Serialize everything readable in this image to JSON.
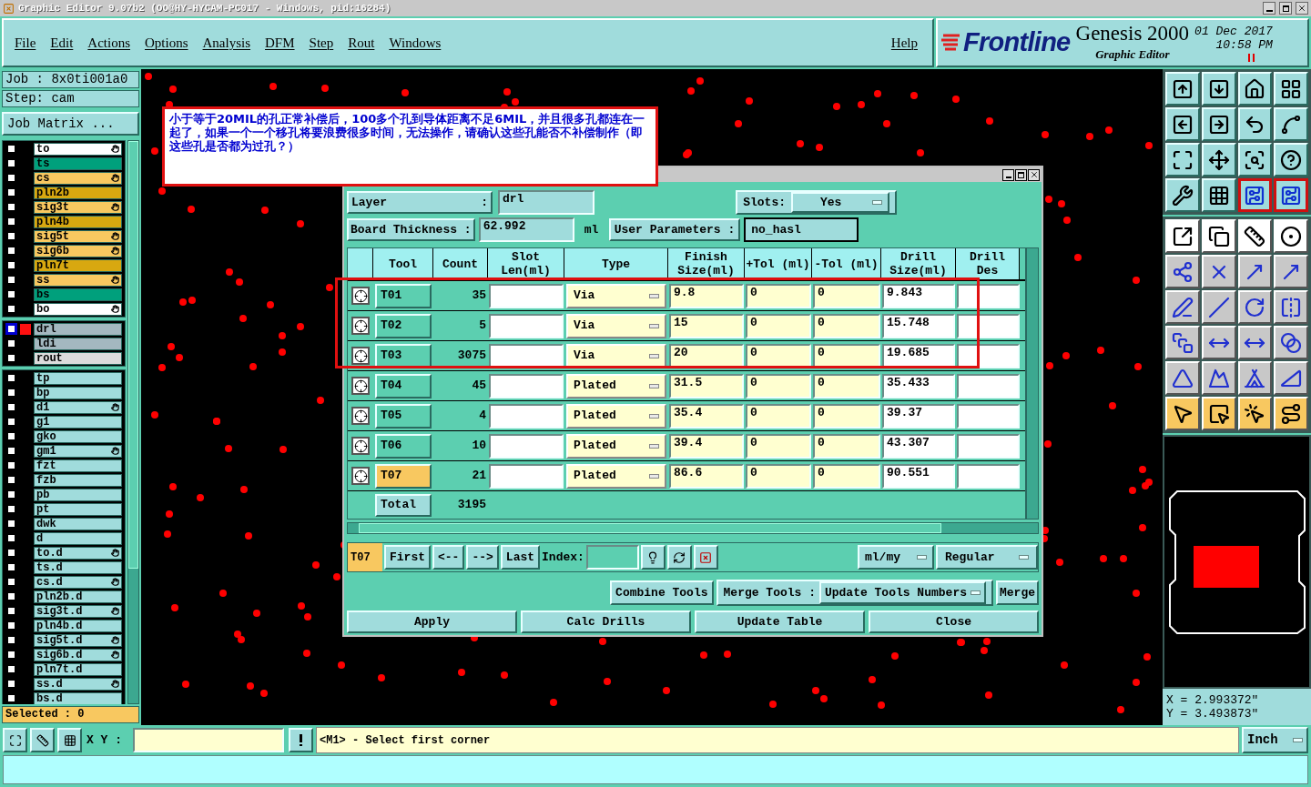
{
  "title_bar": {
    "title": "Graphic Editor 9.07b2 (OO@HY-HYCAM-PC017 - Windows, pid:16284)"
  },
  "menu": [
    "File",
    "Edit",
    "Actions",
    "Options",
    "Analysis",
    "DFM",
    "Step",
    "Rout",
    "Windows"
  ],
  "help": "Help",
  "brand": {
    "logo": "Frontline",
    "product": "Genesis 2000",
    "subtitle": "Graphic Editor",
    "date": "01 Dec 2017",
    "time": "10:58 PM"
  },
  "job": {
    "job": "Job : 8x0ti001a0",
    "step": "Step: cam",
    "matrix_button": "Job Matrix ...",
    "selected": "Selected : 0"
  },
  "layer_groups": [
    [
      {
        "name": "to",
        "color": "#ffffff",
        "marked": true,
        "checked": false,
        "selected": false
      },
      {
        "name": "ts",
        "color": "#00a07c",
        "marked": false,
        "checked": false,
        "selected": false
      },
      {
        "name": "cs",
        "color": "#f8c860",
        "marked": true,
        "checked": false,
        "selected": false
      },
      {
        "name": "pln2b",
        "color": "#d8a810",
        "marked": false,
        "checked": false,
        "selected": false
      },
      {
        "name": "sig3t",
        "color": "#f8c860",
        "marked": true,
        "checked": false,
        "selected": false
      },
      {
        "name": "pln4b",
        "color": "#d8a810",
        "marked": false,
        "checked": false,
        "selected": false
      },
      {
        "name": "sig5t",
        "color": "#f8c860",
        "marked": true,
        "checked": false,
        "selected": false
      },
      {
        "name": "sig6b",
        "color": "#f8c860",
        "marked": true,
        "checked": false,
        "selected": false
      },
      {
        "name": "pln7t",
        "color": "#d8a810",
        "marked": false,
        "checked": false,
        "selected": false
      },
      {
        "name": "ss",
        "color": "#f8c860",
        "marked": true,
        "checked": false,
        "selected": false
      },
      {
        "name": "bs",
        "color": "#00a07c",
        "marked": false,
        "checked": false,
        "selected": false
      },
      {
        "name": "bo",
        "color": "#ffffff",
        "marked": true,
        "checked": false,
        "selected": false
      }
    ],
    [
      {
        "name": "drl",
        "color": "#a4b8c0",
        "marked": false,
        "checked": false,
        "selected": true
      },
      {
        "name": "ldi",
        "color": "#a4b8c0",
        "marked": false,
        "checked": false,
        "selected": false
      },
      {
        "name": "rout",
        "color": "#dcdcdc",
        "marked": false,
        "checked": false,
        "selected": false
      }
    ],
    [
      {
        "name": "tp",
        "color": "#a0dcdc",
        "marked": false,
        "checked": false,
        "selected": false
      },
      {
        "name": "bp",
        "color": "#a0dcdc",
        "marked": false,
        "checked": false,
        "selected": false
      },
      {
        "name": "d1",
        "color": "#a0dcdc",
        "marked": true,
        "checked": false,
        "selected": false
      },
      {
        "name": "g1",
        "color": "#a0dcdc",
        "marked": false,
        "checked": false,
        "selected": false
      },
      {
        "name": "gko",
        "color": "#a0dcdc",
        "marked": false,
        "checked": false,
        "selected": false
      },
      {
        "name": "gm1",
        "color": "#a0dcdc",
        "marked": true,
        "checked": false,
        "selected": false
      },
      {
        "name": "fzt",
        "color": "#a0dcdc",
        "marked": false,
        "checked": false,
        "selected": false
      },
      {
        "name": "fzb",
        "color": "#a0dcdc",
        "marked": false,
        "checked": false,
        "selected": false
      },
      {
        "name": "pb",
        "color": "#a0dcdc",
        "marked": false,
        "checked": false,
        "selected": false
      },
      {
        "name": "pt",
        "color": "#a0dcdc",
        "marked": false,
        "checked": false,
        "selected": false
      },
      {
        "name": "dwk",
        "color": "#a0dcdc",
        "marked": false,
        "checked": false,
        "selected": false
      },
      {
        "name": "d",
        "color": "#a0dcdc",
        "marked": false,
        "checked": false,
        "selected": false
      },
      {
        "name": "to.d",
        "color": "#a0dcdc",
        "marked": true,
        "checked": false,
        "selected": false
      },
      {
        "name": "ts.d",
        "color": "#a0dcdc",
        "marked": false,
        "checked": false,
        "selected": false
      },
      {
        "name": "cs.d",
        "color": "#a0dcdc",
        "marked": true,
        "checked": false,
        "selected": false
      },
      {
        "name": "pln2b.d",
        "color": "#a0dcdc",
        "marked": false,
        "checked": false,
        "selected": false
      },
      {
        "name": "sig3t.d",
        "color": "#a0dcdc",
        "marked": true,
        "checked": false,
        "selected": false
      },
      {
        "name": "pln4b.d",
        "color": "#a0dcdc",
        "marked": false,
        "checked": false,
        "selected": false
      },
      {
        "name": "sig5t.d",
        "color": "#a0dcdc",
        "marked": true,
        "checked": false,
        "selected": false
      },
      {
        "name": "sig6b.d",
        "color": "#a0dcdc",
        "marked": true,
        "checked": false,
        "selected": false
      },
      {
        "name": "pln7t.d",
        "color": "#a0dcdc",
        "marked": false,
        "checked": false,
        "selected": false
      },
      {
        "name": "ss.d",
        "color": "#a0dcdc",
        "marked": true,
        "checked": false,
        "selected": false
      },
      {
        "name": "bs.d",
        "color": "#a0dcdc",
        "marked": false,
        "checked": false,
        "selected": false
      }
    ]
  ],
  "annotation": "小于等于20MIL的孔正常补偿后，100多个孔到导体距离不足6MIL，并且很多孔都连在一起了，如果一个一个移孔将要浪费很多时间，无法操作，请确认这些孔能否不补偿制作（即这些孔是否都为过孔？）",
  "dialog": {
    "layer_label": "Layer",
    "layer_colon": ":",
    "layer_value": "drl",
    "slots_label": "Slots:",
    "slots_value": "Yes",
    "thickness_label": "Board Thickness :",
    "thickness_value": "62.992",
    "thickness_unit": "ml",
    "user_params_button": "User Parameters :",
    "user_params_value": "no_hasl",
    "columns": [
      "Tool",
      "Count",
      "Slot Len(ml)",
      "Type",
      "Finish Size(ml)",
      "+Tol (ml)",
      "-Tol (ml)",
      "Drill Size(ml)",
      "Drill Des"
    ],
    "rows": [
      {
        "tool": "T01",
        "count": "35",
        "type": "Via",
        "finish": "9.8",
        "plus_tol": "0",
        "minus_tol": "0",
        "drill": "9.843",
        "selected": false
      },
      {
        "tool": "T02",
        "count": "5",
        "type": "Via",
        "finish": "15",
        "plus_tol": "0",
        "minus_tol": "0",
        "drill": "15.748",
        "selected": false
      },
      {
        "tool": "T03",
        "count": "3075",
        "type": "Via",
        "finish": "20",
        "plus_tol": "0",
        "minus_tol": "0",
        "drill": "19.685",
        "selected": false
      },
      {
        "tool": "T04",
        "count": "45",
        "type": "Plated",
        "finish": "31.5",
        "plus_tol": "0",
        "minus_tol": "0",
        "drill": "35.433",
        "selected": false
      },
      {
        "tool": "T05",
        "count": "4",
        "type": "Plated",
        "finish": "35.4",
        "plus_tol": "0",
        "minus_tol": "0",
        "drill": "39.37",
        "selected": false
      },
      {
        "tool": "T06",
        "count": "10",
        "type": "Plated",
        "finish": "39.4",
        "plus_tol": "0",
        "minus_tol": "0",
        "drill": "43.307",
        "selected": false
      },
      {
        "tool": "T07",
        "count": "21",
        "type": "Plated",
        "finish": "86.6",
        "plus_tol": "0",
        "minus_tol": "0",
        "drill": "90.551",
        "selected": true
      }
    ],
    "total_label": "Total",
    "total_count": "3195",
    "current_tool": "T07",
    "nav_buttons": [
      "First",
      "<--",
      "-->",
      "Last"
    ],
    "index_label": "Index:",
    "units": "ml/my",
    "mode": "Regular",
    "combine_button": "Combine Tools",
    "merge_label": "Merge Tools :",
    "update_numbers": "Update Tools Numbers",
    "merge_button": "Merge",
    "actions": [
      "Apply",
      "Calc Drills",
      "Update Table",
      "Close"
    ]
  },
  "bottom": {
    "xy_label": "X Y :",
    "message": "<M1> - Select first corner",
    "units": "Inch"
  },
  "coords": {
    "x": "X = 2.993372\"",
    "y": "Y = 3.493873\""
  },
  "toolbar": [
    {
      "selected": false
    },
    {
      "selected": false
    },
    {
      "selected": false
    },
    {
      "selected": false
    },
    {
      "selected": false
    },
    {
      "selected": false
    },
    {
      "selected": false
    },
    {
      "selected": false
    },
    {
      "selected": false
    },
    {
      "selected": false
    },
    {
      "selected": false
    },
    {
      "selected": false
    },
    {
      "selected": false
    },
    {
      "selected": false
    },
    {
      "selected": true
    },
    {
      "selected": true
    }
  ]
}
